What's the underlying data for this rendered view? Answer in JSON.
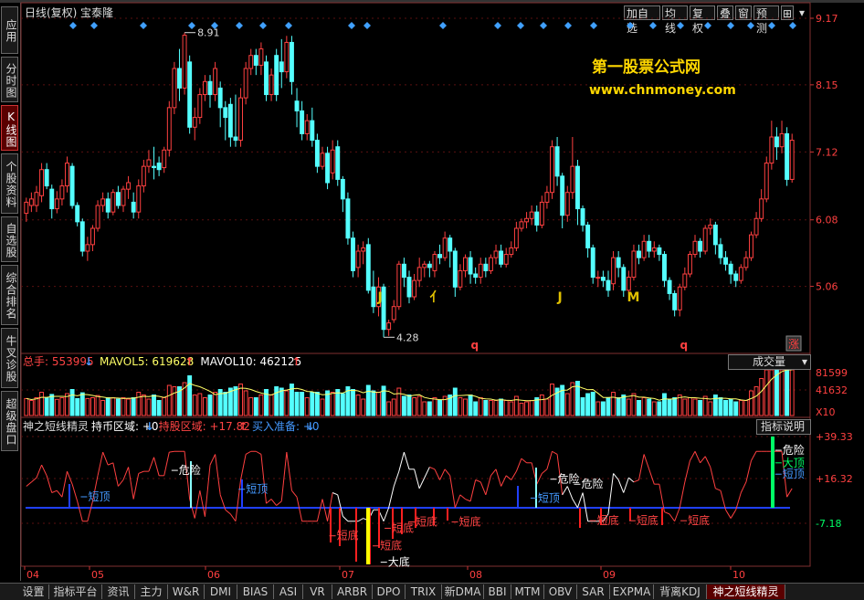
{
  "chart_data": {
    "type": "candlestick",
    "title": "日线(复权)",
    "stock_name": "宝泰隆",
    "price_axis_labels": [
      "9.17",
      "8.15",
      "7.12",
      "6.08",
      "5.06"
    ],
    "price_ylim": [
      4.06,
      9.17
    ],
    "high_label": "8.91",
    "low_label": "4.28",
    "x_tick_labels": [
      "04",
      "05",
      "06",
      "07",
      "08",
      "09",
      "10"
    ],
    "watermark_line1": "第一股票公式网",
    "watermark_line2": "www.chnmoney.com",
    "candles": [
      [
        6.18,
        6.35,
        6.05,
        6.42
      ],
      [
        6.3,
        6.4,
        6.2,
        6.5
      ],
      [
        6.3,
        6.5,
        6.2,
        6.6
      ],
      [
        6.45,
        6.85,
        6.35,
        6.95
      ],
      [
        6.85,
        6.6,
        6.55,
        6.95
      ],
      [
        6.55,
        6.25,
        6.1,
        6.62
      ],
      [
        6.25,
        6.4,
        6.18,
        6.52
      ],
      [
        6.4,
        6.6,
        6.3,
        6.7
      ],
      [
        6.6,
        6.95,
        6.5,
        7.05
      ],
      [
        6.9,
        6.3,
        6.25,
        6.95
      ],
      [
        6.3,
        6.05,
        5.98,
        6.35
      ],
      [
        6.05,
        5.6,
        5.52,
        6.1
      ],
      [
        5.6,
        5.7,
        5.45,
        5.82
      ],
      [
        5.7,
        5.95,
        5.6,
        6.0
      ],
      [
        5.95,
        6.3,
        5.9,
        6.38
      ],
      [
        6.3,
        6.4,
        6.2,
        6.5
      ],
      [
        6.4,
        6.2,
        6.1,
        6.5
      ],
      [
        6.2,
        6.5,
        6.15,
        6.55
      ],
      [
        6.5,
        6.3,
        6.25,
        6.6
      ],
      [
        6.3,
        6.55,
        6.2,
        6.6
      ],
      [
        6.55,
        6.65,
        6.4,
        6.75
      ],
      [
        6.35,
        6.2,
        6.1,
        6.5
      ],
      [
        6.2,
        6.6,
        6.1,
        6.7
      ],
      [
        6.6,
        6.9,
        6.5,
        7.0
      ],
      [
        6.9,
        7.0,
        6.8,
        7.15
      ],
      [
        6.9,
        6.88,
        6.7,
        7.2
      ],
      [
        6.95,
        6.85,
        6.75,
        7.05
      ],
      [
        6.88,
        7.15,
        6.8,
        7.2
      ],
      [
        7.15,
        7.8,
        7.05,
        7.9
      ],
      [
        7.8,
        8.4,
        7.7,
        8.5
      ],
      [
        8.4,
        8.1,
        7.9,
        8.7
      ],
      [
        8.1,
        8.91,
        8.0,
        8.95
      ],
      [
        8.5,
        7.5,
        7.4,
        8.6
      ],
      [
        7.5,
        7.65,
        7.3,
        7.8
      ],
      [
        7.65,
        8.0,
        7.55,
        8.1
      ],
      [
        8.0,
        8.2,
        7.9,
        8.3
      ],
      [
        8.2,
        8.0,
        7.8,
        8.3
      ],
      [
        8.0,
        8.4,
        7.9,
        8.5
      ],
      [
        8.1,
        7.8,
        7.5,
        8.2
      ],
      [
        7.8,
        7.65,
        7.3,
        7.9
      ],
      [
        7.85,
        7.35,
        7.2,
        7.95
      ],
      [
        7.35,
        7.3,
        7.2,
        8.0
      ],
      [
        7.3,
        7.95,
        7.2,
        8.1
      ],
      [
        7.95,
        8.4,
        7.85,
        8.5
      ],
      [
        8.4,
        8.6,
        8.3,
        8.7
      ],
      [
        8.6,
        8.45,
        8.3,
        8.7
      ],
      [
        8.45,
        8.7,
        8.3,
        8.8
      ],
      [
        8.5,
        8.0,
        7.9,
        8.6
      ],
      [
        8.0,
        8.3,
        7.9,
        8.4
      ],
      [
        8.6,
        8.0,
        7.9,
        8.7
      ],
      [
        8.5,
        8.35,
        8.1,
        8.85
      ],
      [
        8.35,
        8.8,
        8.25,
        8.9
      ],
      [
        8.8,
        8.2,
        8.0,
        8.9
      ],
      [
        7.9,
        7.75,
        7.5,
        8.1
      ],
      [
        7.75,
        7.4,
        7.3,
        7.9
      ],
      [
        7.4,
        7.6,
        7.3,
        7.7
      ],
      [
        7.6,
        7.3,
        7.2,
        7.8
      ],
      [
        7.3,
        6.9,
        6.8,
        7.4
      ],
      [
        6.9,
        7.1,
        6.85,
        7.2
      ],
      [
        7.1,
        6.65,
        6.55,
        7.2
      ],
      [
        6.8,
        7.15,
        6.7,
        7.3
      ],
      [
        7.2,
        6.7,
        6.6,
        7.3
      ],
      [
        6.7,
        6.4,
        6.2,
        6.75
      ],
      [
        6.4,
        5.8,
        5.7,
        6.5
      ],
      [
        5.8,
        5.3,
        5.2,
        5.9
      ],
      [
        5.35,
        5.6,
        5.2,
        5.7
      ],
      [
        5.6,
        5.65,
        5.4,
        5.75
      ],
      [
        5.7,
        5.0,
        4.95,
        5.8
      ],
      [
        5.05,
        4.75,
        4.65,
        5.3
      ],
      [
        4.75,
        5.05,
        4.6,
        5.2
      ],
      [
        5.05,
        4.4,
        4.28,
        5.1
      ],
      [
        4.4,
        4.5,
        4.3,
        4.55
      ],
      [
        4.55,
        4.75,
        4.5,
        4.85
      ],
      [
        4.75,
        5.4,
        4.7,
        5.45
      ],
      [
        5.4,
        5.2,
        5.05,
        5.5
      ],
      [
        5.2,
        4.9,
        4.8,
        5.3
      ],
      [
        4.9,
        5.15,
        4.85,
        5.25
      ],
      [
        5.15,
        5.35,
        5.05,
        5.5
      ],
      [
        5.35,
        5.4,
        5.2,
        5.45
      ],
      [
        5.4,
        5.35,
        5.2,
        5.45
      ],
      [
        5.3,
        5.55,
        5.2,
        5.6
      ],
      [
        5.55,
        5.5,
        5.4,
        5.7
      ],
      [
        5.5,
        5.8,
        5.45,
        5.9
      ],
      [
        5.8,
        5.6,
        5.35,
        5.85
      ],
      [
        5.6,
        5.05,
        4.9,
        5.65
      ],
      [
        5.05,
        5.3,
        5.0,
        5.4
      ],
      [
        5.3,
        5.5,
        5.2,
        5.55
      ],
      [
        5.5,
        5.25,
        5.1,
        5.6
      ],
      [
        5.25,
        5.2,
        5.1,
        5.35
      ],
      [
        5.2,
        5.4,
        5.1,
        5.5
      ],
      [
        5.4,
        5.3,
        5.2,
        5.5
      ],
      [
        5.3,
        5.5,
        5.25,
        5.55
      ],
      [
        5.5,
        5.6,
        5.4,
        5.7
      ],
      [
        5.6,
        5.4,
        5.35,
        5.7
      ],
      [
        5.4,
        5.55,
        5.35,
        5.65
      ],
      [
        5.55,
        5.65,
        5.5,
        5.75
      ],
      [
        5.65,
        5.95,
        5.6,
        6.05
      ],
      [
        5.95,
        6.05,
        5.9,
        6.1
      ],
      [
        6.05,
        6.1,
        5.95,
        6.2
      ],
      [
        6.1,
        6.2,
        6.0,
        6.3
      ],
      [
        6.2,
        6.0,
        5.9,
        6.3
      ],
      [
        6.0,
        6.35,
        5.95,
        6.45
      ],
      [
        6.35,
        6.5,
        6.25,
        6.6
      ],
      [
        6.5,
        7.2,
        6.4,
        7.3
      ],
      [
        7.2,
        6.75,
        6.6,
        7.35
      ],
      [
        6.75,
        6.15,
        5.95,
        6.8
      ],
      [
        6.15,
        6.5,
        6.05,
        6.6
      ],
      [
        6.5,
        6.9,
        6.4,
        7.35
      ],
      [
        6.9,
        6.25,
        6.0,
        7.0
      ],
      [
        6.25,
        6.0,
        5.9,
        6.3
      ],
      [
        6.0,
        5.65,
        5.5,
        6.05
      ],
      [
        5.65,
        5.2,
        5.1,
        5.7
      ],
      [
        5.2,
        5.2,
        5.05,
        5.3
      ],
      [
        5.2,
        5.15,
        5.05,
        5.3
      ],
      [
        5.15,
        5.0,
        4.9,
        5.3
      ],
      [
        5.1,
        5.5,
        5.0,
        5.6
      ],
      [
        5.5,
        5.35,
        5.2,
        5.6
      ],
      [
        5.35,
        5.0,
        4.9,
        5.4
      ],
      [
        5.0,
        5.2,
        4.95,
        5.3
      ],
      [
        5.2,
        5.6,
        5.15,
        5.7
      ],
      [
        5.6,
        5.5,
        5.4,
        5.7
      ],
      [
        5.5,
        5.75,
        5.45,
        5.85
      ],
      [
        5.75,
        5.6,
        5.5,
        5.85
      ],
      [
        5.6,
        5.65,
        5.5,
        5.75
      ],
      [
        5.65,
        5.55,
        5.45,
        5.7
      ],
      [
        5.55,
        5.15,
        5.05,
        5.6
      ],
      [
        5.15,
        4.95,
        4.85,
        5.2
      ],
      [
        4.95,
        4.7,
        4.6,
        5.0
      ],
      [
        4.7,
        5.05,
        4.6,
        5.1
      ],
      [
        5.05,
        5.25,
        5.0,
        5.35
      ],
      [
        5.25,
        5.55,
        5.2,
        5.6
      ],
      [
        5.55,
        5.75,
        5.5,
        5.85
      ],
      [
        5.75,
        5.6,
        5.5,
        5.8
      ],
      [
        5.6,
        5.95,
        5.55,
        6.0
      ],
      [
        5.95,
        6.0,
        5.85,
        6.1
      ],
      [
        6.0,
        5.7,
        5.55,
        6.05
      ],
      [
        5.7,
        5.5,
        5.4,
        5.8
      ],
      [
        5.5,
        5.4,
        5.3,
        5.6
      ],
      [
        5.4,
        5.25,
        5.1,
        5.45
      ],
      [
        5.25,
        5.15,
        5.05,
        5.3
      ],
      [
        5.15,
        5.35,
        5.1,
        5.4
      ],
      [
        5.35,
        5.5,
        5.3,
        5.6
      ],
      [
        5.5,
        5.85,
        5.45,
        5.9
      ],
      [
        5.85,
        6.1,
        5.8,
        6.2
      ],
      [
        6.1,
        6.4,
        6.05,
        6.55
      ],
      [
        6.4,
        6.95,
        6.35,
        7.05
      ],
      [
        6.95,
        7.35,
        6.85,
        7.6
      ],
      [
        7.35,
        7.2,
        7.0,
        7.5
      ],
      [
        7.2,
        7.4,
        7.1,
        7.6
      ],
      [
        7.4,
        6.7,
        6.6,
        7.5
      ],
      [
        6.7,
        7.3,
        6.65,
        7.4
      ]
    ],
    "indicator_marks": [
      {
        "x": 0.452,
        "text": "J"
      },
      {
        "x": 0.518,
        "text": "亻"
      },
      {
        "x": 0.68,
        "text": "J"
      },
      {
        "x": 0.768,
        "text": "M"
      }
    ],
    "red_q_marks": [
      {
        "x": 0.57,
        "text": "q"
      },
      {
        "x": 0.835,
        "text": "q"
      }
    ],
    "zhang_badge": "涨",
    "volume": {
      "header": [
        {
          "label": "总手: 553995",
          "color": "#ff4444",
          "arrow": "↓",
          "arrow_color": "#4499ff"
        },
        {
          "label": "MAVOL5: 619628",
          "color": "#ffff66",
          "arrow": "↑",
          "arrow_color": "#ff4444"
        },
        {
          "label": "MAVOL10: 462125",
          "color": "#ffffff",
          "arrow": "↑",
          "arrow_color": "#ff4444"
        }
      ],
      "axis_labels": [
        "81599",
        "41632",
        "X10"
      ],
      "dropdown_label": "成交量"
    },
    "indicator": {
      "name": "神之短线精灵",
      "header": [
        {
          "label": "持币区域: +0",
          "color": "#ffffff",
          "arrow": "↓",
          "arrow_color": "#4499ff"
        },
        {
          "label": "持股区域: +17.82",
          "color": "#ff4444",
          "arrow": "↑",
          "arrow_color": "#ff4444"
        },
        {
          "label": "买入准备: +0",
          "color": "#4499ff",
          "arrow": "↓",
          "arrow_color": "#4499ff"
        }
      ],
      "explain_button": "指标说明",
      "axis_labels": [
        "+39.33",
        "+16.32",
        "-7.18"
      ],
      "labels": [
        {
          "text": "危险",
          "x": 0.2,
          "y": 0.32,
          "color": "#ffffff"
        },
        {
          "text": "短顶",
          "x": 0.085,
          "y": 0.53,
          "color": "#4499ff"
        },
        {
          "text": "短顶",
          "x": 0.285,
          "y": 0.47,
          "color": "#4499ff"
        },
        {
          "text": "危险",
          "x": 0.68,
          "y": 0.39,
          "color": "#ffffff"
        },
        {
          "text": "短顶",
          "x": 0.655,
          "y": 0.54,
          "color": "#4499ff"
        },
        {
          "text": "危险",
          "x": 0.71,
          "y": 0.43,
          "color": "#ffffff"
        },
        {
          "text": "危险",
          "x": 0.965,
          "y": 0.16,
          "color": "#ffffff"
        },
        {
          "text": "大顶",
          "x": 0.965,
          "y": 0.26,
          "color": "#00ff66"
        },
        {
          "text": "短顶",
          "x": 0.965,
          "y": 0.35,
          "color": "#4499ff"
        },
        {
          "text": "短底",
          "x": 0.4,
          "y": 0.84,
          "color": "#ff4444"
        },
        {
          "text": "短底",
          "x": 0.455,
          "y": 0.92,
          "color": "#ff4444"
        },
        {
          "text": "短底",
          "x": 0.47,
          "y": 0.78,
          "color": "#ff4444"
        },
        {
          "text": "短底",
          "x": 0.5,
          "y": 0.73,
          "color": "#ff4444"
        },
        {
          "text": "短底",
          "x": 0.555,
          "y": 0.73,
          "color": "#ff4444"
        },
        {
          "text": "短底",
          "x": 0.73,
          "y": 0.72,
          "color": "#ff4444"
        },
        {
          "text": "短底",
          "x": 0.78,
          "y": 0.72,
          "color": "#ff4444"
        },
        {
          "text": "短底",
          "x": 0.845,
          "y": 0.72,
          "color": "#ff4444"
        },
        {
          "text": "大底",
          "x": 0.465,
          "y": 1.05,
          "color": "#ffffff"
        }
      ]
    }
  },
  "toolbar": {
    "add_watch": "加自选",
    "ma_line": "均线",
    "adjust": "复权",
    "overlay": "叠",
    "window": "窗",
    "forecast": "预测"
  },
  "sidebar": [
    {
      "label": "应用",
      "active": false
    },
    {
      "label": "分时图",
      "active": false
    },
    {
      "label": "K线图",
      "active": true
    },
    {
      "label": "个股资料",
      "active": false
    },
    {
      "label": "自选股",
      "active": false
    },
    {
      "label": "综合排名",
      "active": false
    },
    {
      "label": "牛叉诊股",
      "active": false
    },
    {
      "label": "超级盘口",
      "active": false
    }
  ],
  "bottom_tabs": [
    "设置",
    "指标平台",
    "资讯",
    "主力",
    "W&R",
    "DMI",
    "BIAS",
    "ASI",
    "VR",
    "ARBR",
    "DPO",
    "TRIX",
    "新DMA",
    "BBI",
    "MTM",
    "OBV",
    "SAR",
    "EXPMA",
    "背离KDJ",
    "神之短线精灵"
  ]
}
